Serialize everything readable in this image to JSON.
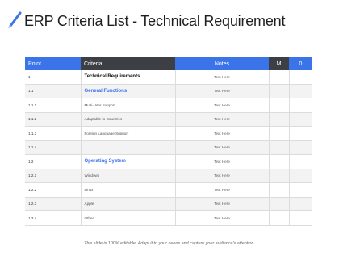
{
  "title": "ERP Criteria List - Technical Requirement",
  "table": {
    "headers": {
      "point": "Point",
      "criteria": "Criteria",
      "notes": "Notes",
      "m": "M",
      "o": "0"
    },
    "rows": [
      {
        "point": "1",
        "criteria": "Technical Requirements",
        "notes": "Text Here",
        "style": "heading"
      },
      {
        "point": "1.1",
        "criteria": "General Functions",
        "notes": "Text Here",
        "style": "section"
      },
      {
        "point": "1.1.1",
        "criteria": "Multi-User Support",
        "notes": "Text Here",
        "style": "normal"
      },
      {
        "point": "1.1.2",
        "criteria": "Adaptable to Countries",
        "notes": "Text Here",
        "style": "normal"
      },
      {
        "point": "1.1.3",
        "criteria": "Foreign Language Support",
        "notes": "Text Here",
        "style": "normal"
      },
      {
        "point": "1.1.4",
        "criteria": "",
        "notes": "Text Here",
        "style": "normal"
      },
      {
        "point": "1.2",
        "criteria": "Operating System",
        "notes": "Text Here",
        "style": "section"
      },
      {
        "point": "1.2.1",
        "criteria": "Windows",
        "notes": "Text Here",
        "style": "normal"
      },
      {
        "point": "1.2.2",
        "criteria": "Linux",
        "notes": "Text Here",
        "style": "normal"
      },
      {
        "point": "1.2.3",
        "criteria": "Apple",
        "notes": "Text Here",
        "style": "normal"
      },
      {
        "point": "1.2.4",
        "criteria": "Other",
        "notes": "Text Here",
        "style": "normal"
      }
    ]
  },
  "footer": "This slide is 100% editable. Adapt it to your needs and capture your audience's attention.",
  "colors": {
    "accent_blue": "#3b73e8",
    "header_dark": "#3d3f45"
  },
  "icons": {
    "title_icon": "pen-icon"
  }
}
